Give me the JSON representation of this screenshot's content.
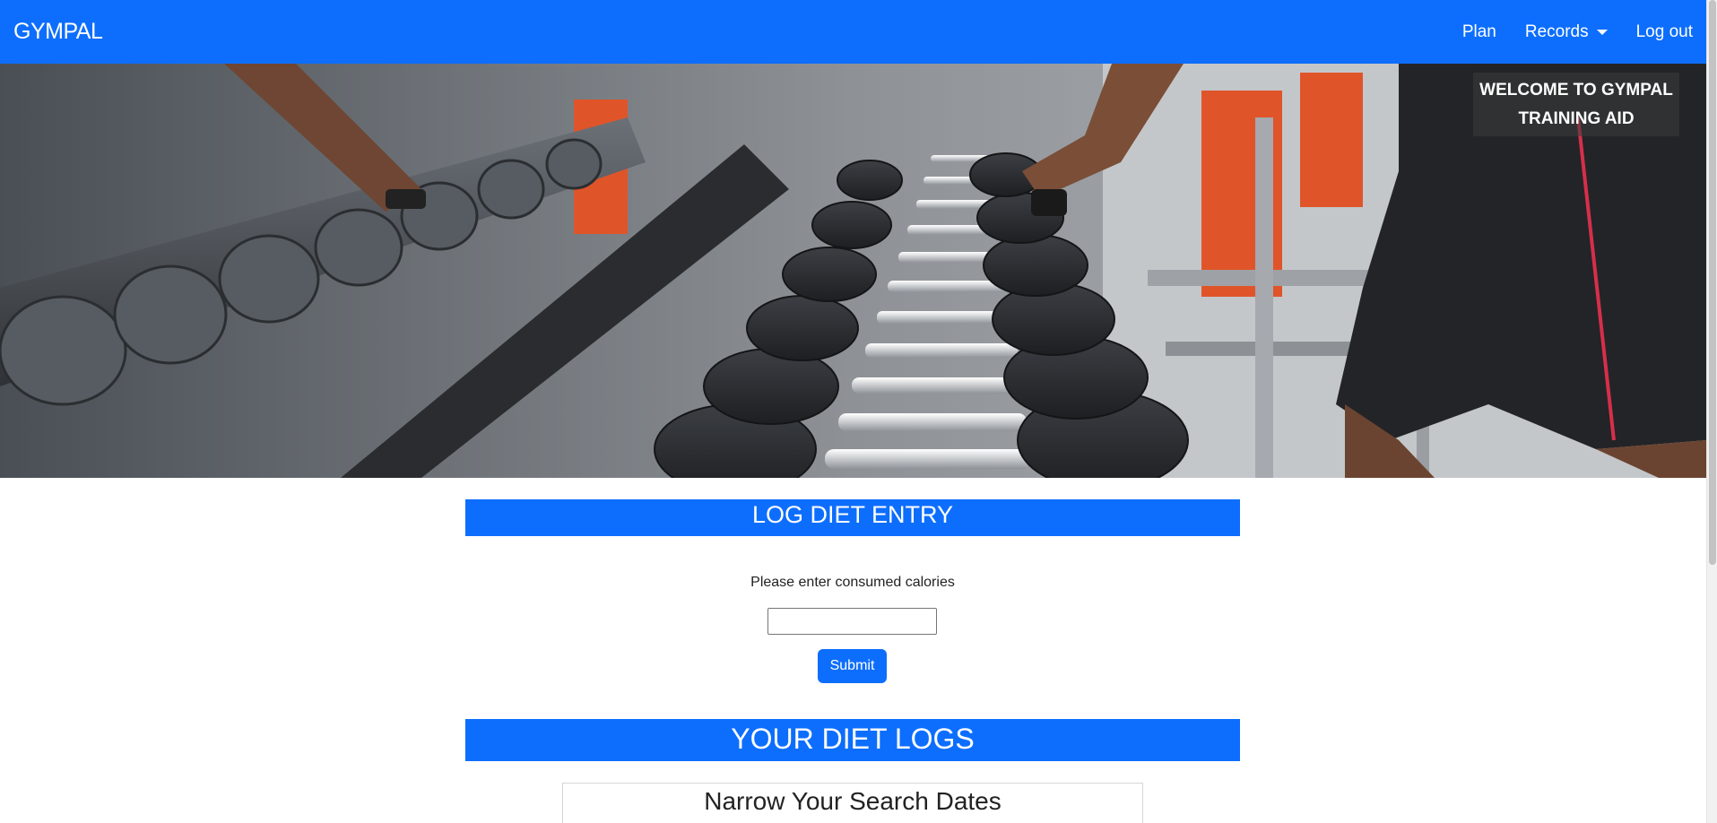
{
  "navbar": {
    "brand": "GYMPAL",
    "links": {
      "plan": "Plan",
      "records": "Records",
      "logout": "Log out"
    }
  },
  "hero": {
    "welcome_line1": "WELCOME TO GYMPAL",
    "welcome_line2": "TRAINING AID"
  },
  "log_entry": {
    "header": "LOG DIET ENTRY",
    "prompt": "Please enter consumed calories",
    "input_value": "",
    "submit_label": "Submit"
  },
  "diet_logs": {
    "header": "YOUR DIET LOGS",
    "search_title": "Narrow Your Search Dates"
  },
  "colors": {
    "primary": "#0d6efd",
    "accent_orange": "#e0542a"
  }
}
